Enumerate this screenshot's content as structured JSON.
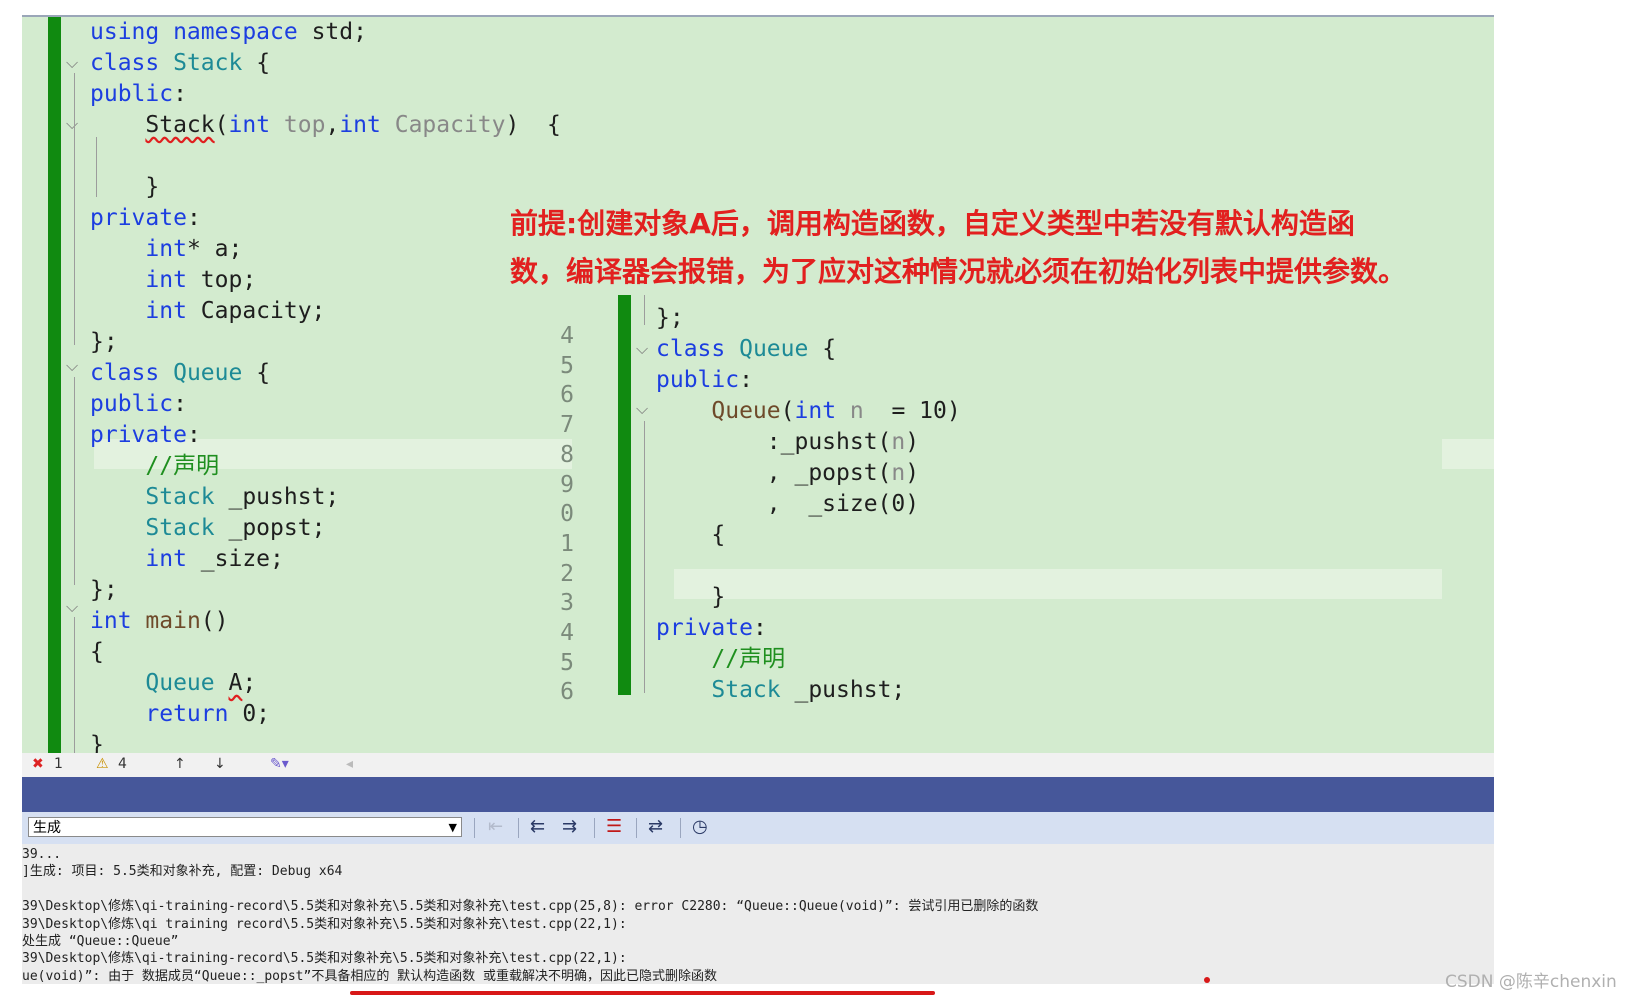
{
  "left_code": {
    "lines": [
      [
        "kw:using namespace",
        "t: std;"
      ],
      [
        "kw:class",
        "t: ",
        "ty:Stack",
        "t: {"
      ],
      [
        "kw:public",
        "t::"
      ],
      [
        "t:    ",
        "sq:Stack",
        "t:(",
        "kw:int",
        "t: ",
        "pm:top",
        "t:,",
        "kw:int",
        "t: ",
        "pm:Capacity",
        "t:)  {"
      ],
      [
        "t: "
      ],
      [
        "t:    }"
      ],
      [
        "kw:private",
        "t::"
      ],
      [
        "t:    ",
        "kw:int",
        "t:* a;"
      ],
      [
        "t:    ",
        "kw:int",
        "t: top;"
      ],
      [
        "t:    ",
        "kw:int",
        "t: Capacity;"
      ],
      [
        "t:};"
      ],
      [
        "kw:class",
        "t: ",
        "ty:Queue",
        "t: {"
      ],
      [
        "kw:public",
        "t::"
      ],
      [
        "kw:private",
        "t::"
      ],
      [
        "t:    ",
        "cm://声明"
      ],
      [
        "t:    ",
        "ty:Stack",
        "t: _pushst;"
      ],
      [
        "t:    ",
        "ty:Stack",
        "t: _popst;"
      ],
      [
        "t:    ",
        "kw:int",
        "t: _size;"
      ],
      [
        "t:};"
      ],
      [
        "kw:int",
        "t: ",
        "fn:main",
        "t:()"
      ],
      [
        "t:{"
      ],
      [
        "t:    ",
        "ty:Queue",
        "t: ",
        "sq:A",
        "t:;"
      ],
      [
        "t:    ",
        "kw:return",
        "t: 0;"
      ],
      [
        "t:}"
      ]
    ]
  },
  "right_code": {
    "line_numbers": [
      "4",
      "5",
      "6",
      "7",
      "8",
      "9",
      "0",
      "1",
      "2",
      "3",
      "4",
      "5",
      "6"
    ],
    "lines": [
      [
        "t:};"
      ],
      [
        "kw:class",
        "t: ",
        "ty:Queue",
        "t: {"
      ],
      [
        "kw:public",
        "t::"
      ],
      [
        "t:    ",
        "fn:Queue",
        "t:(",
        "kw:int",
        "t: ",
        "pm:n",
        "t:  = 10)"
      ],
      [
        "t:        :_pushst(",
        "pm:n",
        "t:)"
      ],
      [
        "t:        , _popst(",
        "pm:n",
        "t:)"
      ],
      [
        "t:        ,  _size(0)"
      ],
      [
        "t:    {"
      ],
      [
        "t: "
      ],
      [
        "t:    }"
      ],
      [
        "kw:private",
        "t::"
      ],
      [
        "t:    ",
        "cm://声明"
      ],
      [
        "t:    ",
        "ty:Stack",
        "t: _pushst;"
      ]
    ]
  },
  "annotation": {
    "text": "前提:创建对象A后，调用构造函数，自定义类型中若没有默认构造函数，编译器会报错，为了应对这种情况就必须在初始化列表中提供参数。"
  },
  "status_bar": {
    "errors": "1",
    "warnings": "4"
  },
  "output_panel": {
    "source_value": "生成",
    "lines": [
      "39...",
      "]生成: 项目: 5.5类和对象补充, 配置: Debug x64",
      "",
      "39\\Desktop\\修炼\\qi-training-record\\5.5类和对象补充\\5.5类和对象补充\\test.cpp(25,8): error C2280: “Queue::Queue(void)”: 尝试引用已删除的函数",
      "39\\Desktop\\修炼\\qi training record\\5.5类和对象补充\\5.5类和对象补充\\test.cpp(22,1):",
      "处生成 “Queue::Queue”",
      "39\\Desktop\\修炼\\qi-training-record\\5.5类和对象补充\\5.5类和对象补充\\test.cpp(22,1):",
      "ue(void)”: 由于 数据成员“Queue::_popst”不具备相应的 默认构造函数 或重载解决不明确，因此已隐式删除函数"
    ]
  },
  "watermark": "CSDN @陈辛chenxin"
}
